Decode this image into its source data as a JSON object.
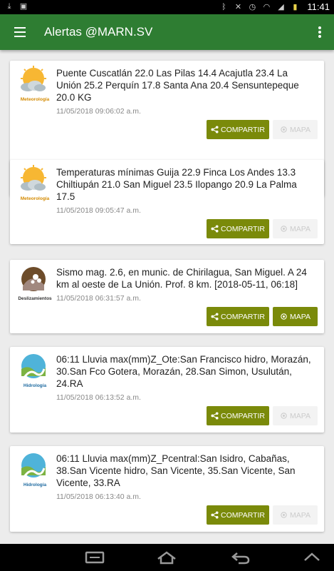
{
  "statusbar": {
    "time": "11:41",
    "left_icons": [
      "download-icon",
      "image-icon"
    ],
    "right_icons": [
      "bluetooth-icon",
      "mute-icon",
      "alarm-icon",
      "wifi-icon",
      "signal-icon",
      "battery-icon"
    ]
  },
  "appbar": {
    "title": "Alertas @MARN.SV"
  },
  "alerts": [
    {
      "category": "Meteorología",
      "icon": "meteorology-icon",
      "text": "Puente Cuscatlán 22.0 Las Pilas 14.4 Acajutla 23.4 La Unión 25.2 Perquín 17.8 Santa Ana 20.4 Sensuntepeque 20.0 KG",
      "date": "11/05/2018 09:06:02 a.m.",
      "share_label": "COMPARTIR",
      "map_label": "MAPA",
      "map_enabled": false
    },
    {
      "category": "Meteorología",
      "icon": "meteorology-icon",
      "text": "Temperaturas mínimas Guija 22.9 Finca Los Andes 13.3 Chiltiupán 21.0 San Miguel 23.5 Ilopango 20.9 La Palma 17.5",
      "date": "11/05/2018 09:05:47 a.m.",
      "share_label": "COMPARTIR",
      "map_label": "MAPA",
      "map_enabled": false
    },
    {
      "category": "Deslizamientos",
      "icon": "landslide-icon",
      "text": "Sismo mag. 2.6, en munic. de Chirilagua, San Miguel. A 24 km al oeste de La Unión. Prof. 8 km. [2018-05-11, 06:18]",
      "date": "11/05/2018 06:31:57 a.m.",
      "share_label": "COMPARTIR",
      "map_label": "MAPA",
      "map_enabled": true
    },
    {
      "category": "Hidrología",
      "icon": "hydrology-icon",
      "text": "06:11 Lluvia max(mm)Z_Ote:San Francisco hidro, Morazán, 30.San Fco Gotera, Morazán, 28.San Simon, Usulután, 24.RA",
      "date": "11/05/2018 06:13:52 a.m.",
      "share_label": "COMPARTIR",
      "map_label": "MAPA",
      "map_enabled": false
    },
    {
      "category": "Hidrología",
      "icon": "hydrology-icon",
      "text": "06:11 Lluvia max(mm)Z_Pcentral:San Isidro, Cabañas, 38.San Vicente hidro, San Vicente, 35.San Vicente, San Vicente, 33.RA",
      "date": "11/05/2018 06:13:40 a.m.",
      "share_label": "COMPARTIR",
      "map_label": "MAPA",
      "map_enabled": false
    }
  ],
  "colors": {
    "appbar": "#2e7d32",
    "button": "#7a8a0a",
    "background": "#ececec"
  }
}
